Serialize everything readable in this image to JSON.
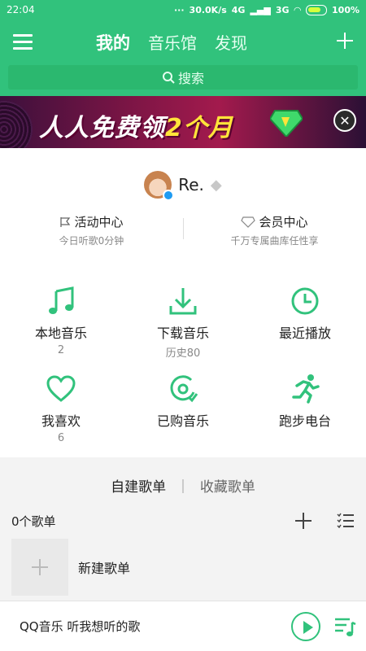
{
  "status_bar": {
    "time": "22:04",
    "net_speed": "30.0K/s",
    "signal_4g": "4G",
    "signal_3g": "3G",
    "battery": "100%"
  },
  "nav": {
    "tabs": [
      {
        "label": "我的",
        "active": true
      },
      {
        "label": "音乐馆",
        "active": false
      },
      {
        "label": "发现",
        "active": false
      }
    ]
  },
  "search": {
    "placeholder": "搜索"
  },
  "banner": {
    "text_part1": "人人免费领",
    "text_part2": "2个月"
  },
  "profile": {
    "username": "Re.",
    "activity_center": {
      "title": "活动中心",
      "subtitle": "今日听歌0分钟"
    },
    "vip_center": {
      "title": "会员中心",
      "subtitle": "千万专属曲库任性享"
    }
  },
  "shortcuts": [
    {
      "label": "本地音乐",
      "count": "2",
      "icon": "music-note-icon"
    },
    {
      "label": "下载音乐",
      "count": "历史80",
      "icon": "download-icon"
    },
    {
      "label": "最近播放",
      "count": "",
      "icon": "clock-icon"
    },
    {
      "label": "我喜欢",
      "count": "6",
      "icon": "heart-icon"
    },
    {
      "label": "已购音乐",
      "count": "",
      "icon": "purchased-music-icon"
    },
    {
      "label": "跑步电台",
      "count": "",
      "icon": "running-icon"
    }
  ],
  "playlists": {
    "tab_created": "自建歌单",
    "tab_collected": "收藏歌单",
    "count_label": "0个歌单",
    "new_playlist_label": "新建歌单"
  },
  "player": {
    "text": "QQ音乐 听我想听的歌"
  },
  "colors": {
    "brand": "#31c27c"
  }
}
